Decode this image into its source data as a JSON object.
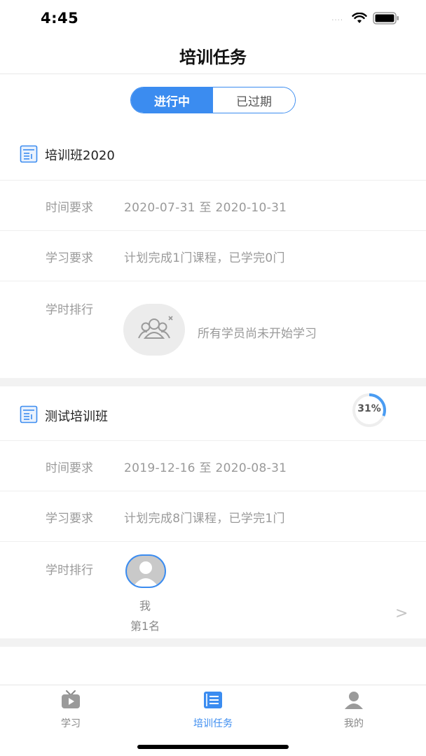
{
  "status_bar": {
    "time": "4:45",
    "signal": "....",
    "wifi_icon": "wifi-icon",
    "battery_icon": "battery-icon"
  },
  "nav": {
    "title": "培训任务"
  },
  "segment": {
    "active_label": "进行中",
    "inactive_label": "已过期",
    "accent": "#3b8cf0"
  },
  "cards": [
    {
      "title": "培训班2020",
      "time_label": "时间要求",
      "time_value": "2020-07-31 至 2020-10-31",
      "study_label": "学习要求",
      "study_value": "计划完成1门课程，已学完0门",
      "rank_label": "学时排行",
      "empty_text": "所有学员尚未开始学习"
    },
    {
      "title": "测试培训班",
      "progress_text": "31%",
      "progress": 0.31,
      "time_label": "时间要求",
      "time_value": "2019-12-16 至 2020-08-31",
      "study_label": "学习要求",
      "study_value": "计划完成8门课程，已学完1门",
      "rank_label": "学时排行",
      "rank_name": "我",
      "rank_position": "第1名",
      "chevron": ">"
    }
  ],
  "tabs": [
    {
      "label": "学习",
      "icon": "tv-icon",
      "active": false
    },
    {
      "label": "培训任务",
      "icon": "task-list-icon",
      "active": true
    },
    {
      "label": "我的",
      "icon": "person-icon",
      "active": false
    }
  ],
  "colors": {
    "accent": "#3b8cf0",
    "muted": "#9a9a9a",
    "band": "#f2f2f2"
  }
}
